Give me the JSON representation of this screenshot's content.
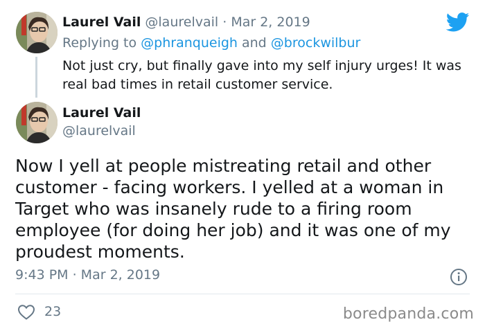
{
  "reply_tweet": {
    "author_name": "Laurel Vail",
    "author_handle": "@laurelvail",
    "separator": "·",
    "date": "Mar 2, 2019",
    "replying_prefix": "Replying to",
    "replying_user_1": "@phranqueigh",
    "replying_and": "and",
    "replying_user_2": "@brockwilbur",
    "text": "Not just cry, but finally gave into my self injury urges! It was real bad times in retail customer service."
  },
  "main_tweet": {
    "author_name": "Laurel Vail",
    "author_handle": "@laurelvail",
    "text": "Now I yell at people mistreating retail and other customer - facing workers. I yelled at a woman in Target who was insanely rude to a firing room employee (for doing her job) and it was one of my proudest moments.",
    "timestamp": "9:43 PM · Mar 2, 2019",
    "like_count": "23"
  },
  "icons": {
    "brand": "twitter-bird-icon",
    "info": "info-icon",
    "like": "heart-icon"
  },
  "watermark": "boredpanda.com",
  "colors": {
    "twitter_blue": "#1da1f2",
    "link_blue": "#1b95e0",
    "muted_gray": "#657786",
    "thread_line": "#ccd6dd",
    "divider": "#e1e8ed"
  }
}
